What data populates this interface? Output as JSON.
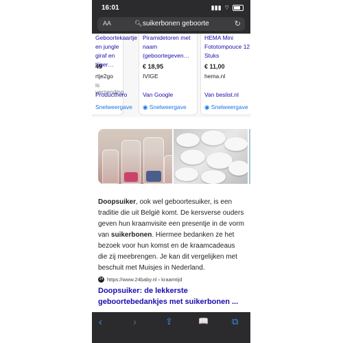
{
  "status": {
    "time": "16:01",
    "signal": "▮▮▮",
    "wifi": "⌔"
  },
  "browser": {
    "aa_label": "AA",
    "url": "suikerbonen geboorte",
    "icons": {
      "lock": "lock-icon",
      "reload": "reload-icon"
    }
  },
  "shopping": {
    "cards": [
      {
        "title": "Geboortekaartje en jungle giraf en tijger…",
        "price": "49",
        "shop": "rtje2go",
        "shipping": "is verzending",
        "via": "Producthero",
        "quick": "Snelweergave"
      },
      {
        "title": "Piramidetoren met naam (geboortegeven…",
        "price": "€ 18,95",
        "shop": "IVIGE",
        "shipping": "",
        "via": "Van Google",
        "quick": "Snelweergave"
      },
      {
        "title": "HEMA Mini Fototompouce 12 Stuks",
        "price": "€ 11,00",
        "shop": "hema.nl",
        "shipping": "",
        "via": "Van beslist.nl",
        "quick": "Snelweergave"
      }
    ]
  },
  "snippet": {
    "bold1": "Doopsuiker",
    "text1": ", ook wel geboortesuiker, is een traditie die uit België komt. De kersverse ouders geven hun kraamvisite een presentje in de vorm van ",
    "bold2": "suikerbonen",
    "text2": ". Hiermee bedanken ze het bezoek voor hun komst en de kraamcadeaus die zij meebrengen. Je kan dit vergelijken met beschuit met Muisjes in Nederland."
  },
  "result": {
    "favicon": "24",
    "source": "https://www.24baby.nl › kraamtijd",
    "title": "Doopsuiker: de lekkerste geboortebedankjes met suikerbonen ..."
  },
  "toolbar": {
    "back": "‹",
    "forward": "›",
    "share": "⇪",
    "bookmarks": "📖",
    "tabs": "⧉"
  },
  "colors": {
    "link": "#1a0dab",
    "accent": "#1a73e8",
    "chrome": "#2b2b2d",
    "toolbar_icon": "#3a8ef6"
  }
}
